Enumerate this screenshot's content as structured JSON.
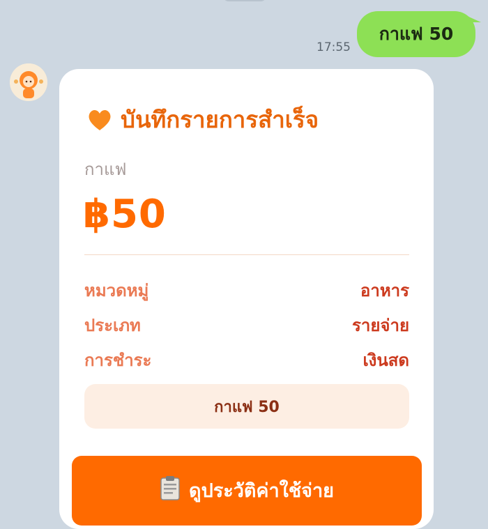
{
  "chat": {
    "outgoing_message": "กาแฟ 50",
    "outgoing_time": "17:55"
  },
  "card": {
    "title": "บันทึกรายการสำเร็จ",
    "item_name": "กาแฟ",
    "amount": "฿50",
    "details": [
      {
        "label": "หมวดหมู่",
        "value": "อาหาร"
      },
      {
        "label": "ประเภท",
        "value": "รายจ่าย"
      },
      {
        "label": "การชำระ",
        "value": "เงินสด"
      }
    ],
    "note": "กาแฟ 50",
    "button_label": "ดูประวัติค่าใช้จ่าย"
  },
  "icons": {
    "heart": "orange-heart-icon",
    "button": "clipboard-icon",
    "avatar": "bot-avatar"
  },
  "colors": {
    "accent": "#ff6a00",
    "title": "#e8650a",
    "label": "#ea7a54",
    "value": "#cc3a1e",
    "bubble_out": "#8de055",
    "background": "#cdd7e1"
  }
}
